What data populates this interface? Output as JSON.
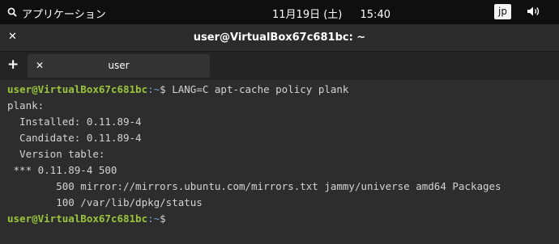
{
  "topbar": {
    "apps_label": "アプリケーション",
    "date": "11月19日 (土)",
    "time": "15:40",
    "ime": "jp",
    "volume_icon": "speaker-icon"
  },
  "window": {
    "title": "user@VirtualBox67c681bc: ~"
  },
  "tabs": [
    {
      "label": "user"
    }
  ],
  "terminal": {
    "prompt_user": "user@VirtualBox67c681bc",
    "prompt_path": ":~",
    "prompt_symbol": "$",
    "command": " LANG=C apt-cache policy plank",
    "output": [
      "plank:",
      "  Installed: 0.11.89-4",
      "  Candidate: 0.11.89-4",
      "  Version table:",
      " *** 0.11.89-4 500",
      "        500 mirror://mirrors.ubuntu.com/mirrors.txt jammy/universe amd64 Packages",
      "        100 /var/lib/dpkg/status"
    ]
  }
}
